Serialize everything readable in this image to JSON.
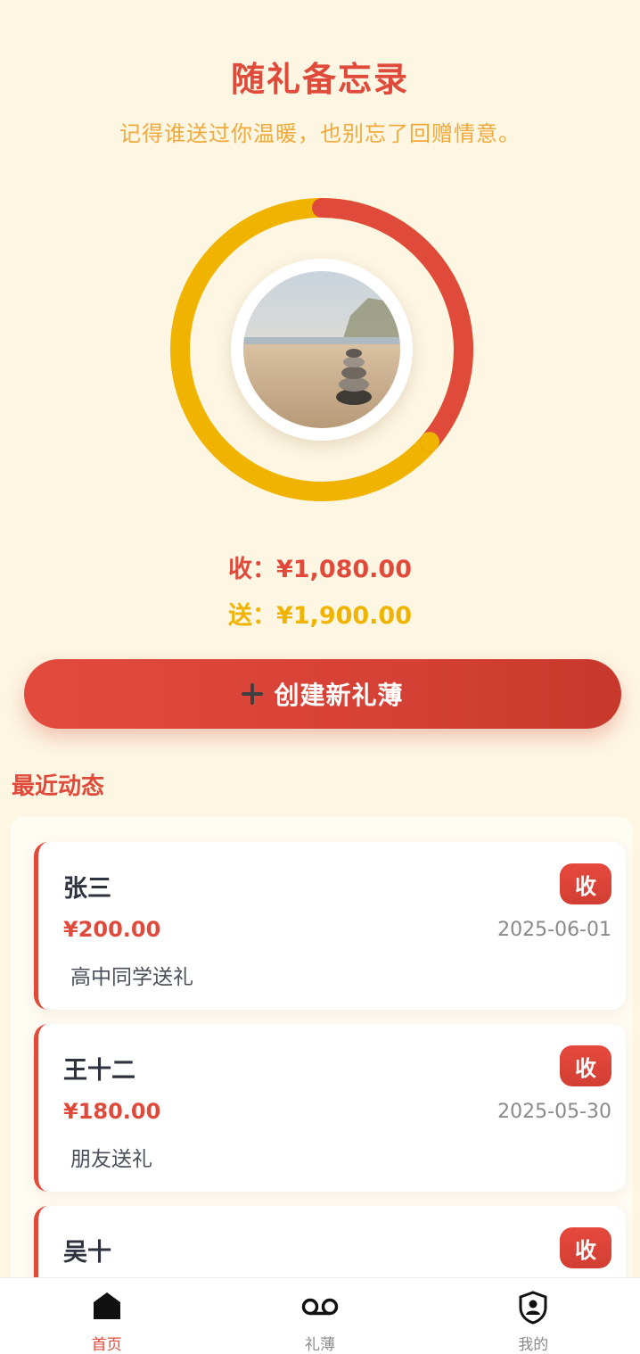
{
  "header": {
    "title": "随礼备忘录",
    "subtitle": "记得谁送过你温暖，也别忘了回赠情意。"
  },
  "summary": {
    "received_label": "收：",
    "received_amount": "¥1,080.00",
    "sent_label": "送：",
    "sent_amount": "¥1,900.00",
    "received_value": 1080,
    "sent_value": 1900,
    "received_color": "#e04a3b",
    "sent_color": "#f0b400",
    "center_image": "stacked-stones-beach-photo"
  },
  "create_button": {
    "icon": "plus-icon",
    "label": "创建新礼薄"
  },
  "recent": {
    "title": "最近动态",
    "items": [
      {
        "name": "张三",
        "badge": "收",
        "amount": "¥200.00",
        "date": "2025-06-01",
        "note": "高中同学送礼"
      },
      {
        "name": "王十二",
        "badge": "收",
        "amount": "¥180.00",
        "date": "2025-05-30",
        "note": "朋友送礼"
      },
      {
        "name": "吴十",
        "badge": "收",
        "amount": "",
        "date": "",
        "note": ""
      }
    ]
  },
  "tabbar": {
    "tabs": [
      {
        "label": "首页",
        "icon": "home-icon",
        "active": true
      },
      {
        "label": "礼薄",
        "icon": "voicemail-icon",
        "active": false
      },
      {
        "label": "我的",
        "icon": "user-shield-icon",
        "active": false
      }
    ],
    "active_color": "#e04a3b"
  }
}
